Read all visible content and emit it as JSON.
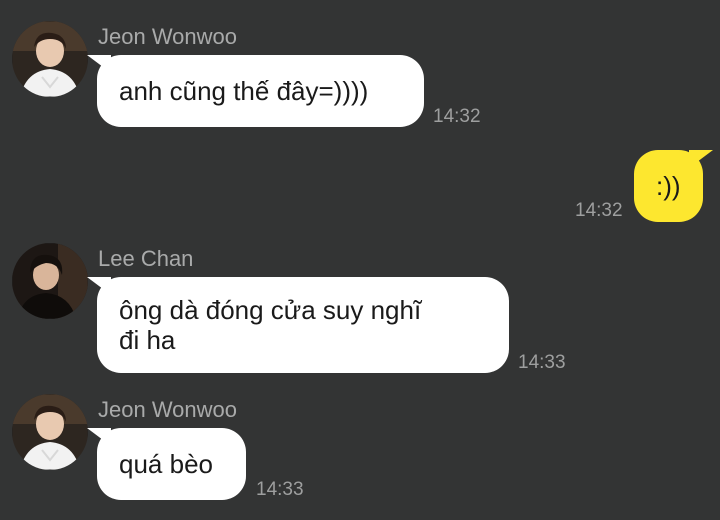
{
  "colors": {
    "background": "#333434",
    "incoming_bubble": "#ffffff",
    "outgoing_bubble": "#fde72f",
    "sender_name": "#a9aaaa",
    "timestamp": "#9e9f9f"
  },
  "messages": [
    {
      "direction": "incoming",
      "sender": "Jeon Wonwoo",
      "text": "anh cũng thế đây=))))",
      "time": "14:32"
    },
    {
      "direction": "outgoing",
      "text": ":))",
      "time": "14:32"
    },
    {
      "direction": "incoming",
      "sender": "Lee Chan",
      "text_line1": "ông dà đóng cửa suy nghĩ",
      "text_line2": "đi ha",
      "time": "14:33"
    },
    {
      "direction": "incoming",
      "sender": "Jeon Wonwoo",
      "text": "quá bèo",
      "time": "14:33"
    }
  ]
}
